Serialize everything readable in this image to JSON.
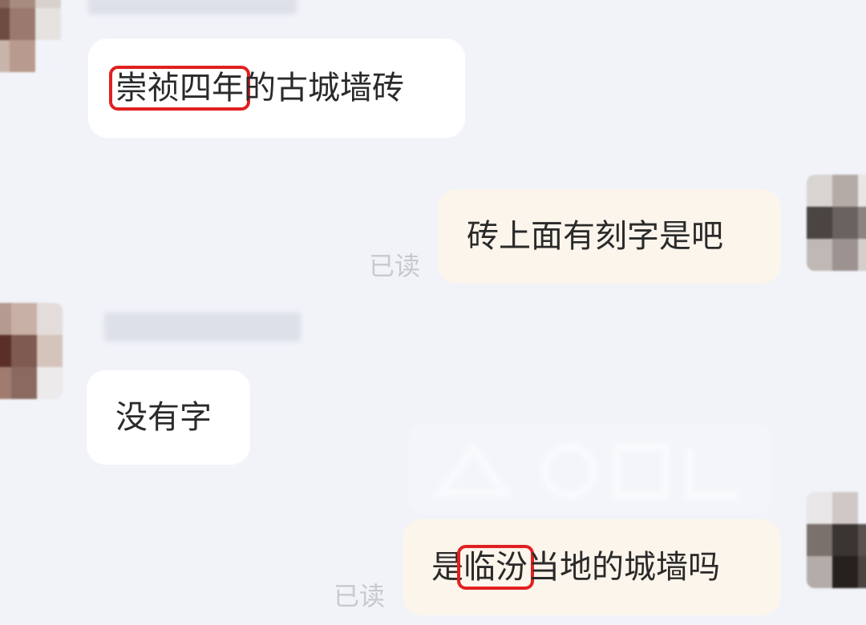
{
  "messages": [
    {
      "side": "received",
      "highlight": "崇祯四年",
      "rest": "的古城墙砖"
    },
    {
      "side": "sent",
      "text": "砖上面有刻字是吧",
      "status": "已读"
    },
    {
      "side": "received",
      "text": "没有字"
    },
    {
      "side": "sent",
      "prefix": "是",
      "highlight": "临汾",
      "rest": "当地的城墙吗",
      "status": "已读"
    }
  ],
  "colors": {
    "background": "#f1f3f9",
    "bubble_received": "#ffffff",
    "bubble_sent": "#fbf5ec",
    "highlight_box": "#e02020",
    "read_receipt": "#c7c9cf"
  },
  "icons": [
    "avatar-pixelated",
    "watermark-logo"
  ]
}
